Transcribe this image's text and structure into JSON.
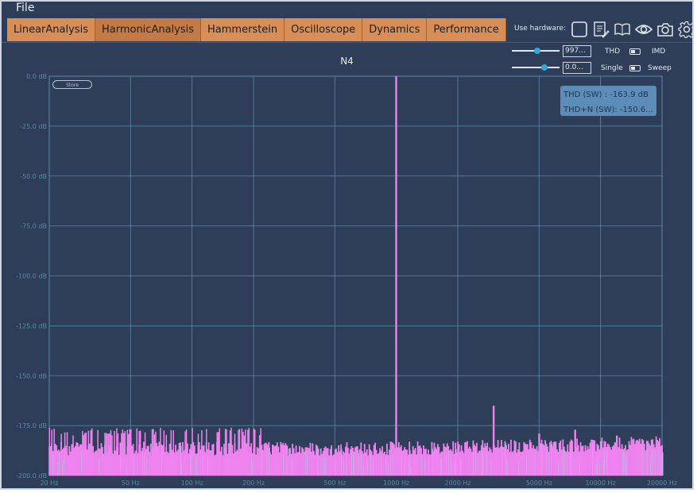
{
  "menu": {
    "file": "File"
  },
  "tabs": [
    {
      "label": "LinearAnalysis",
      "active": false
    },
    {
      "label": "HarmonicAnalysis",
      "active": true
    },
    {
      "label": "Hammerstein",
      "active": false
    },
    {
      "label": "Oscilloscope",
      "active": false
    },
    {
      "label": "Dynamics",
      "active": false
    },
    {
      "label": "Performance",
      "active": false
    }
  ],
  "hardware": {
    "label": "Use hardware:",
    "icons": [
      "checkbox-icon",
      "notes-icon",
      "book-icon",
      "eye-icon",
      "camera-icon",
      "gear-icon"
    ]
  },
  "controls": {
    "frequency_value": "997...",
    "level_value": "0.0...",
    "thd": "THD",
    "imd": "IMD",
    "single": "Single",
    "sweep": "Sweep"
  },
  "store_label": "Store",
  "readout": {
    "thd": "THD (SW) : -163.9 dB",
    "thdn": "THD+N (SW): -150.6..."
  },
  "colors": {
    "background": "#2e3e58",
    "tab": "#d88e55",
    "grid": "#5a8aa6",
    "spectrum": "#ee82ee",
    "noise_secondary": "#9fd8e0",
    "readout_bg": "#5b8db8"
  },
  "chart_data": {
    "type": "bar",
    "title": "N4",
    "x_scale": "log",
    "xlim": [
      20,
      20000
    ],
    "ylim": [
      -200,
      0
    ],
    "x_ticks": [
      20,
      50,
      100,
      200,
      500,
      1000,
      2000,
      5000,
      10000,
      20000
    ],
    "x_tick_labels": [
      "20 Hz",
      "50 Hz",
      "100 Hz",
      "200 Hz",
      "500 Hz",
      "1000 Hz",
      "2000 Hz",
      "5000 Hz",
      "10000 Hz",
      "20000 Hz"
    ],
    "y_ticks": [
      0,
      -25,
      -50,
      -75,
      -100,
      -125,
      -150,
      -175,
      -200
    ],
    "y_tick_labels": [
      "0.0 dB",
      "-25.0 dB",
      "-50.0 dB",
      "-75.0 dB",
      "-100.0 dB",
      "-125.0 dB",
      "-150.0 dB",
      "-175.0 dB",
      "-200.0 dB"
    ],
    "grid": true,
    "peaks": [
      {
        "x": 997,
        "y": 0
      },
      {
        "x": 2991,
        "y": -165
      },
      {
        "x": 7500,
        "y": -177
      },
      {
        "x": 5000,
        "y": -179
      },
      {
        "x": 12000,
        "y": -180
      }
    ],
    "noise_floor_db": -188,
    "noise_floor_low_db": -181,
    "noise_floor_high_db": -184
  }
}
